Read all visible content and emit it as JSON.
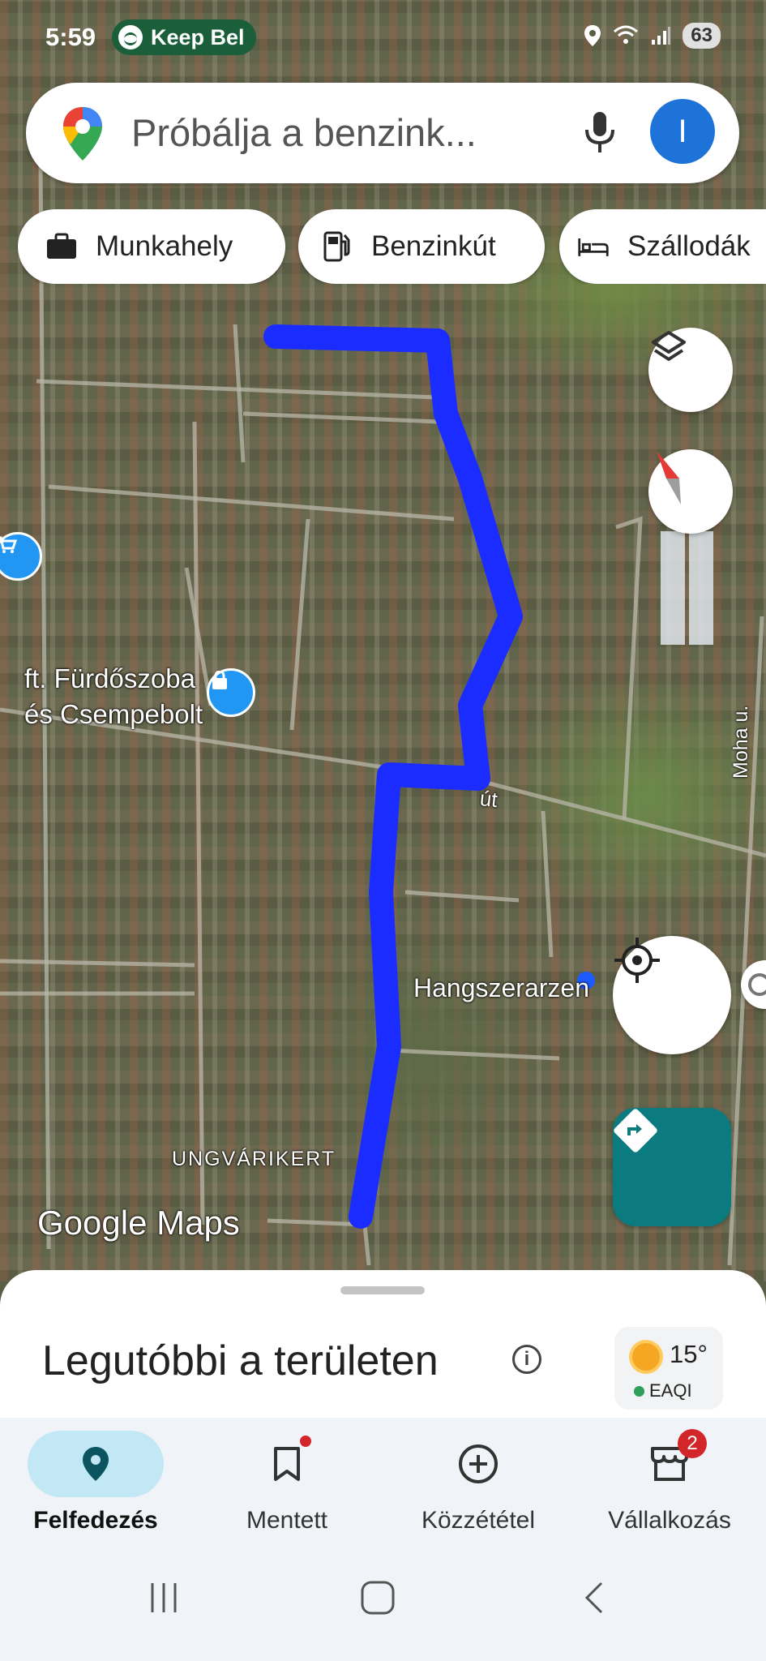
{
  "status_bar": {
    "time": "5:59",
    "spotify_text": "Keep Bel",
    "battery": "63"
  },
  "search": {
    "placeholder": "Próbálja a benzink...",
    "avatar_letter": "I"
  },
  "chips": [
    {
      "label": "Munkahely",
      "icon": "briefcase-icon"
    },
    {
      "label": "Benzinkút",
      "icon": "gas-station-icon"
    },
    {
      "label": "Szállodák",
      "icon": "bed-icon"
    }
  ],
  "map": {
    "labels": {
      "shop_line1": "ft. Fürdőszoba",
      "shop_line2": "és Csempebolt",
      "road": "út",
      "poi": "Hangszerarzen",
      "district": "UNGVÁRIKERT",
      "street": "Moha u.",
      "brand": "Google Maps"
    },
    "route_color": "#1a2cff"
  },
  "sheet": {
    "title": "Legutóbbi a területen",
    "temperature": "15°",
    "air_quality": "EAQI"
  },
  "bottom_nav": [
    {
      "label": "Felfedezés",
      "icon": "explore-pin-icon",
      "active": true
    },
    {
      "label": "Mentett",
      "icon": "bookmark-icon",
      "active": false
    },
    {
      "label": "Közzététel",
      "icon": "add-circle-icon",
      "active": false
    },
    {
      "label": "Vállalkozás",
      "icon": "storefront-icon",
      "active": false,
      "badge": "2"
    }
  ]
}
